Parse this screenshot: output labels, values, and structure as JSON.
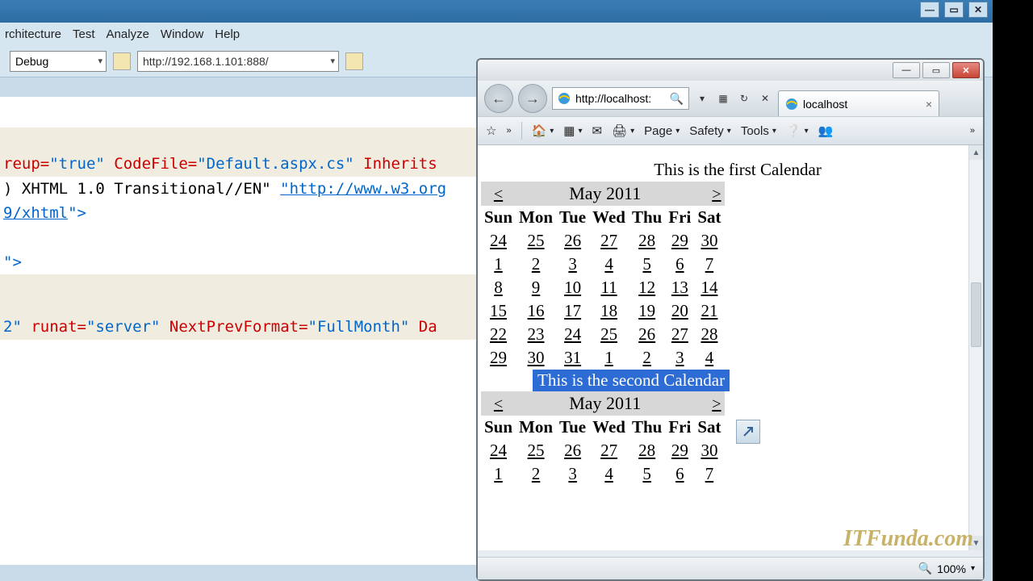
{
  "vs": {
    "menus": [
      "rchitecture",
      "Test",
      "Analyze",
      "Window",
      "Help"
    ],
    "debug_combo": "Debug",
    "url_combo": "http://192.168.1.101:888/",
    "code": {
      "line1_a": "reup=",
      "line1_b": "\"true\"",
      "line1_c": " CodeFile=",
      "line1_d": "\"Default.aspx.cs\"",
      "line1_e": " Inherits",
      "line2_a": ") XHTML 1.0 Transitional//EN\" ",
      "line2_b": "\"http://www.w3.org",
      "line3_a": "9/xhtml",
      "line3_b": "\">",
      "line4": "\">",
      "line5_a": "2\"",
      "line5_b": " runat=",
      "line5_c": "\"server\"",
      "line5_d": " NextPrevFormat=",
      "line5_e": "\"FullMonth\"",
      "line5_f": " Da"
    }
  },
  "ie": {
    "url": "http://localhost:",
    "tab_title": "localhost",
    "tb2": {
      "page": "Page",
      "safety": "Safety",
      "tools": "Tools"
    },
    "zoom": "100%",
    "caption1": "This is the first Calendar",
    "caption2": "This is the second Calendar",
    "cal_title": "May 2011",
    "prev": "<",
    "next": ">",
    "dayhdr": [
      "Sun",
      "Mon",
      "Tue",
      "Wed",
      "Thu",
      "Fri",
      "Sat"
    ],
    "rows1": [
      [
        "24",
        "25",
        "26",
        "27",
        "28",
        "29",
        "30"
      ],
      [
        "1",
        "2",
        "3",
        "4",
        "5",
        "6",
        "7"
      ],
      [
        "8",
        "9",
        "10",
        "11",
        "12",
        "13",
        "14"
      ],
      [
        "15",
        "16",
        "17",
        "18",
        "19",
        "20",
        "21"
      ],
      [
        "22",
        "23",
        "24",
        "25",
        "26",
        "27",
        "28"
      ],
      [
        "29",
        "30",
        "31",
        "1",
        "2",
        "3",
        "4"
      ]
    ],
    "rows2": [
      [
        "24",
        "25",
        "26",
        "27",
        "28",
        "29",
        "30"
      ],
      [
        "1",
        "2",
        "3",
        "4",
        "5",
        "6",
        "7"
      ]
    ]
  },
  "watermark": "ITFunda.com"
}
